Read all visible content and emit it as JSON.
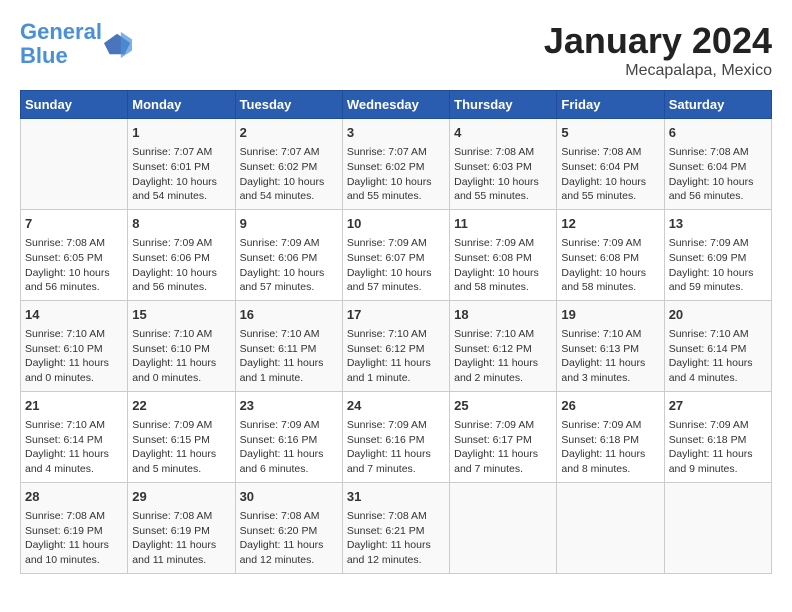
{
  "header": {
    "logo_line1": "General",
    "logo_line2": "Blue",
    "title": "January 2024",
    "subtitle": "Mecapalapa, Mexico"
  },
  "weekdays": [
    "Sunday",
    "Monday",
    "Tuesday",
    "Wednesday",
    "Thursday",
    "Friday",
    "Saturday"
  ],
  "weeks": [
    [
      {
        "day": "",
        "content": ""
      },
      {
        "day": "1",
        "content": "Sunrise: 7:07 AM\nSunset: 6:01 PM\nDaylight: 10 hours\nand 54 minutes."
      },
      {
        "day": "2",
        "content": "Sunrise: 7:07 AM\nSunset: 6:02 PM\nDaylight: 10 hours\nand 54 minutes."
      },
      {
        "day": "3",
        "content": "Sunrise: 7:07 AM\nSunset: 6:02 PM\nDaylight: 10 hours\nand 55 minutes."
      },
      {
        "day": "4",
        "content": "Sunrise: 7:08 AM\nSunset: 6:03 PM\nDaylight: 10 hours\nand 55 minutes."
      },
      {
        "day": "5",
        "content": "Sunrise: 7:08 AM\nSunset: 6:04 PM\nDaylight: 10 hours\nand 55 minutes."
      },
      {
        "day": "6",
        "content": "Sunrise: 7:08 AM\nSunset: 6:04 PM\nDaylight: 10 hours\nand 56 minutes."
      }
    ],
    [
      {
        "day": "7",
        "content": "Sunrise: 7:08 AM\nSunset: 6:05 PM\nDaylight: 10 hours\nand 56 minutes."
      },
      {
        "day": "8",
        "content": "Sunrise: 7:09 AM\nSunset: 6:06 PM\nDaylight: 10 hours\nand 56 minutes."
      },
      {
        "day": "9",
        "content": "Sunrise: 7:09 AM\nSunset: 6:06 PM\nDaylight: 10 hours\nand 57 minutes."
      },
      {
        "day": "10",
        "content": "Sunrise: 7:09 AM\nSunset: 6:07 PM\nDaylight: 10 hours\nand 57 minutes."
      },
      {
        "day": "11",
        "content": "Sunrise: 7:09 AM\nSunset: 6:08 PM\nDaylight: 10 hours\nand 58 minutes."
      },
      {
        "day": "12",
        "content": "Sunrise: 7:09 AM\nSunset: 6:08 PM\nDaylight: 10 hours\nand 58 minutes."
      },
      {
        "day": "13",
        "content": "Sunrise: 7:09 AM\nSunset: 6:09 PM\nDaylight: 10 hours\nand 59 minutes."
      }
    ],
    [
      {
        "day": "14",
        "content": "Sunrise: 7:10 AM\nSunset: 6:10 PM\nDaylight: 11 hours\nand 0 minutes."
      },
      {
        "day": "15",
        "content": "Sunrise: 7:10 AM\nSunset: 6:10 PM\nDaylight: 11 hours\nand 0 minutes."
      },
      {
        "day": "16",
        "content": "Sunrise: 7:10 AM\nSunset: 6:11 PM\nDaylight: 11 hours\nand 1 minute."
      },
      {
        "day": "17",
        "content": "Sunrise: 7:10 AM\nSunset: 6:12 PM\nDaylight: 11 hours\nand 1 minute."
      },
      {
        "day": "18",
        "content": "Sunrise: 7:10 AM\nSunset: 6:12 PM\nDaylight: 11 hours\nand 2 minutes."
      },
      {
        "day": "19",
        "content": "Sunrise: 7:10 AM\nSunset: 6:13 PM\nDaylight: 11 hours\nand 3 minutes."
      },
      {
        "day": "20",
        "content": "Sunrise: 7:10 AM\nSunset: 6:14 PM\nDaylight: 11 hours\nand 4 minutes."
      }
    ],
    [
      {
        "day": "21",
        "content": "Sunrise: 7:10 AM\nSunset: 6:14 PM\nDaylight: 11 hours\nand 4 minutes."
      },
      {
        "day": "22",
        "content": "Sunrise: 7:09 AM\nSunset: 6:15 PM\nDaylight: 11 hours\nand 5 minutes."
      },
      {
        "day": "23",
        "content": "Sunrise: 7:09 AM\nSunset: 6:16 PM\nDaylight: 11 hours\nand 6 minutes."
      },
      {
        "day": "24",
        "content": "Sunrise: 7:09 AM\nSunset: 6:16 PM\nDaylight: 11 hours\nand 7 minutes."
      },
      {
        "day": "25",
        "content": "Sunrise: 7:09 AM\nSunset: 6:17 PM\nDaylight: 11 hours\nand 7 minutes."
      },
      {
        "day": "26",
        "content": "Sunrise: 7:09 AM\nSunset: 6:18 PM\nDaylight: 11 hours\nand 8 minutes."
      },
      {
        "day": "27",
        "content": "Sunrise: 7:09 AM\nSunset: 6:18 PM\nDaylight: 11 hours\nand 9 minutes."
      }
    ],
    [
      {
        "day": "28",
        "content": "Sunrise: 7:08 AM\nSunset: 6:19 PM\nDaylight: 11 hours\nand 10 minutes."
      },
      {
        "day": "29",
        "content": "Sunrise: 7:08 AM\nSunset: 6:19 PM\nDaylight: 11 hours\nand 11 minutes."
      },
      {
        "day": "30",
        "content": "Sunrise: 7:08 AM\nSunset: 6:20 PM\nDaylight: 11 hours\nand 12 minutes."
      },
      {
        "day": "31",
        "content": "Sunrise: 7:08 AM\nSunset: 6:21 PM\nDaylight: 11 hours\nand 12 minutes."
      },
      {
        "day": "",
        "content": ""
      },
      {
        "day": "",
        "content": ""
      },
      {
        "day": "",
        "content": ""
      }
    ]
  ]
}
